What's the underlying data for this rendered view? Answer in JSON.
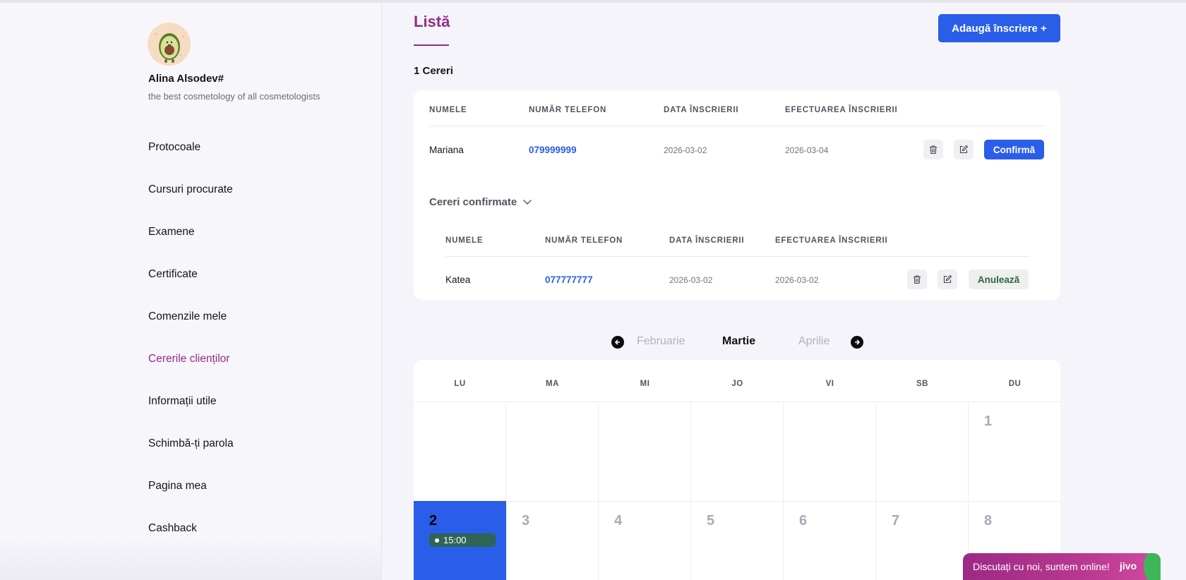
{
  "profile": {
    "name": "Alina Alsodev#",
    "subtitle": "the best cosmetology of all cosmetologists"
  },
  "sidebar": {
    "items": [
      {
        "label": "Protocoale"
      },
      {
        "label": "Cursuri procurate"
      },
      {
        "label": "Examene"
      },
      {
        "label": "Certificate"
      },
      {
        "label": "Comenzile mele"
      },
      {
        "label": "Cererile clienților",
        "active": true
      },
      {
        "label": "Informații utile"
      },
      {
        "label": "Schimbă-ți parola"
      },
      {
        "label": "Pagina mea"
      },
      {
        "label": "Cashback"
      }
    ]
  },
  "main": {
    "title": "Listă",
    "add_button": "Adaugă înscriere +",
    "request_count": "1 Cereri",
    "columns": [
      "NUMELE",
      "NUMĂR TELEFON",
      "DATA ÎNSCRIERII",
      "EFECTUAREA ÎNSCRIERII"
    ],
    "pending": [
      {
        "name": "Mariana",
        "phone": "079999999",
        "signup_date": "2026-03-02",
        "appointment_date": "2026-03-04",
        "action": "Confirmă"
      }
    ],
    "confirmed_toggle": "Cereri confirmate",
    "confirmed": [
      {
        "name": "Katea",
        "phone": "077777777",
        "signup_date": "2026-03-02",
        "appointment_date": "2026-03-02",
        "action": "Anulează"
      }
    ]
  },
  "calendar": {
    "prev_month": "Februarie",
    "current_month": "Martie",
    "next_month": "Aprilie",
    "weekdays": [
      "LU",
      "MA",
      "MI",
      "JO",
      "VI",
      "SB",
      "DU"
    ],
    "days": [
      "1",
      "2",
      "3",
      "4",
      "5",
      "6",
      "7",
      "8"
    ],
    "today_event": "15:00"
  },
  "chat": {
    "text": "Discutați cu noi, suntem online!",
    "brand": "jivo"
  },
  "colors": {
    "accent_purple": "#962a86",
    "primary_blue": "#2a5ee8",
    "event_green": "#2f6457"
  }
}
